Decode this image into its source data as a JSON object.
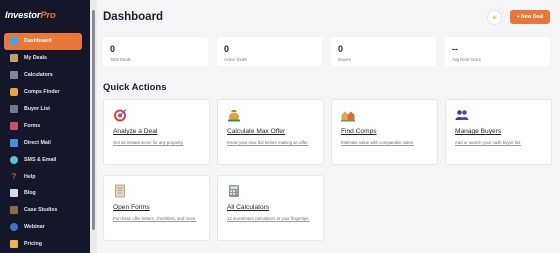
{
  "app": {
    "logo_main": "Investor",
    "logo_accent": "Pro"
  },
  "sidebar": {
    "items": [
      {
        "label": "Dashboard",
        "icon": "dashboard-icon"
      },
      {
        "label": "My Deals",
        "icon": "deals-icon"
      },
      {
        "label": "Calculators",
        "icon": "calculator-icon"
      },
      {
        "label": "Comps Finder",
        "icon": "comps-icon"
      },
      {
        "label": "Buyer List",
        "icon": "buyer-list-icon"
      },
      {
        "label": "Forms",
        "icon": "forms-icon"
      },
      {
        "label": "Direct Mail",
        "icon": "mail-icon"
      },
      {
        "label": "SMS & Email",
        "icon": "sms-icon"
      },
      {
        "label": "Help",
        "icon": "help-icon"
      },
      {
        "label": "Blog",
        "icon": "blog-icon"
      },
      {
        "label": "Case Studies",
        "icon": "case-studies-icon"
      },
      {
        "label": "Webinar",
        "icon": "webinar-icon"
      },
      {
        "label": "Pricing",
        "icon": "pricing-icon"
      }
    ],
    "active_index": 0
  },
  "header": {
    "title": "Dashboard",
    "theme_icon": "☀",
    "new_deal_label": "+ New Deal"
  },
  "stats": [
    {
      "value": "0",
      "label": "Total Deals"
    },
    {
      "value": "0",
      "label": "Active Deals"
    },
    {
      "value": "0",
      "label": "Buyers"
    },
    {
      "value": "--",
      "label": "Avg Deal Score"
    }
  ],
  "quick_actions": {
    "title": "Quick Actions",
    "cards": [
      {
        "title": "Analyze a Deal",
        "desc": "Get an instant score for any property.",
        "icon": "target-icon"
      },
      {
        "title": "Calculate Max Offer",
        "desc": "Know your max bid before making an offer.",
        "icon": "money-bag-icon"
      },
      {
        "title": "Find Comps",
        "desc": "Estimate value with comparable sales.",
        "icon": "houses-icon"
      },
      {
        "title": "Manage Buyers",
        "desc": "Add or search your cash buyer list.",
        "icon": "people-icon"
      },
      {
        "title": "Open Forms",
        "desc": "Purchase offer letters, checklists, and more.",
        "icon": "document-icon"
      },
      {
        "title": "All Calculators",
        "desc": "12 investment calculators at your fingertips.",
        "icon": "calculator-icon"
      }
    ]
  },
  "colors": {
    "accent": "#e8773a",
    "sidebar_bg": "#14172a",
    "page_bg": "#f4f5f7",
    "card_bg": "#ffffff",
    "text_dark": "#1c1f2e"
  }
}
